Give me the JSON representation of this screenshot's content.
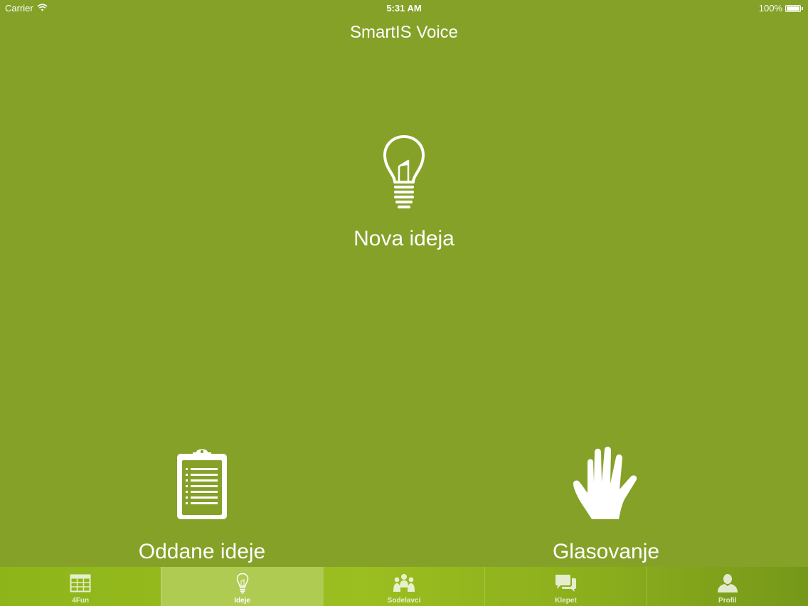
{
  "status_bar": {
    "carrier": "Carrier",
    "time": "5:31 AM",
    "battery": "100%"
  },
  "nav": {
    "title": "SmartIS Voice"
  },
  "actions": {
    "nova_ideja": {
      "label": "Nova ideja",
      "icon": "lightbulb-icon"
    },
    "oddane_ideje": {
      "label": "Oddane ideje",
      "icon": "clipboard-icon"
    },
    "glasovanje": {
      "label": "Glasovanje",
      "icon": "hand-icon"
    }
  },
  "tab_bar": {
    "selected": "Ideje",
    "tabs": [
      {
        "label": "4Fun",
        "icon": "table-icon"
      },
      {
        "label": "Ideje",
        "icon": "lightbulb-icon"
      },
      {
        "label": "Sodelavci",
        "icon": "people-icon"
      },
      {
        "label": "Klepet",
        "icon": "chat-bubbles-icon"
      },
      {
        "label": "Profil",
        "icon": "person-icon"
      }
    ]
  },
  "colors": {
    "background": "#85a128",
    "tab_bar": "#95b81e",
    "tab_selected": "#afcb52",
    "foreground": "#ffffff"
  }
}
